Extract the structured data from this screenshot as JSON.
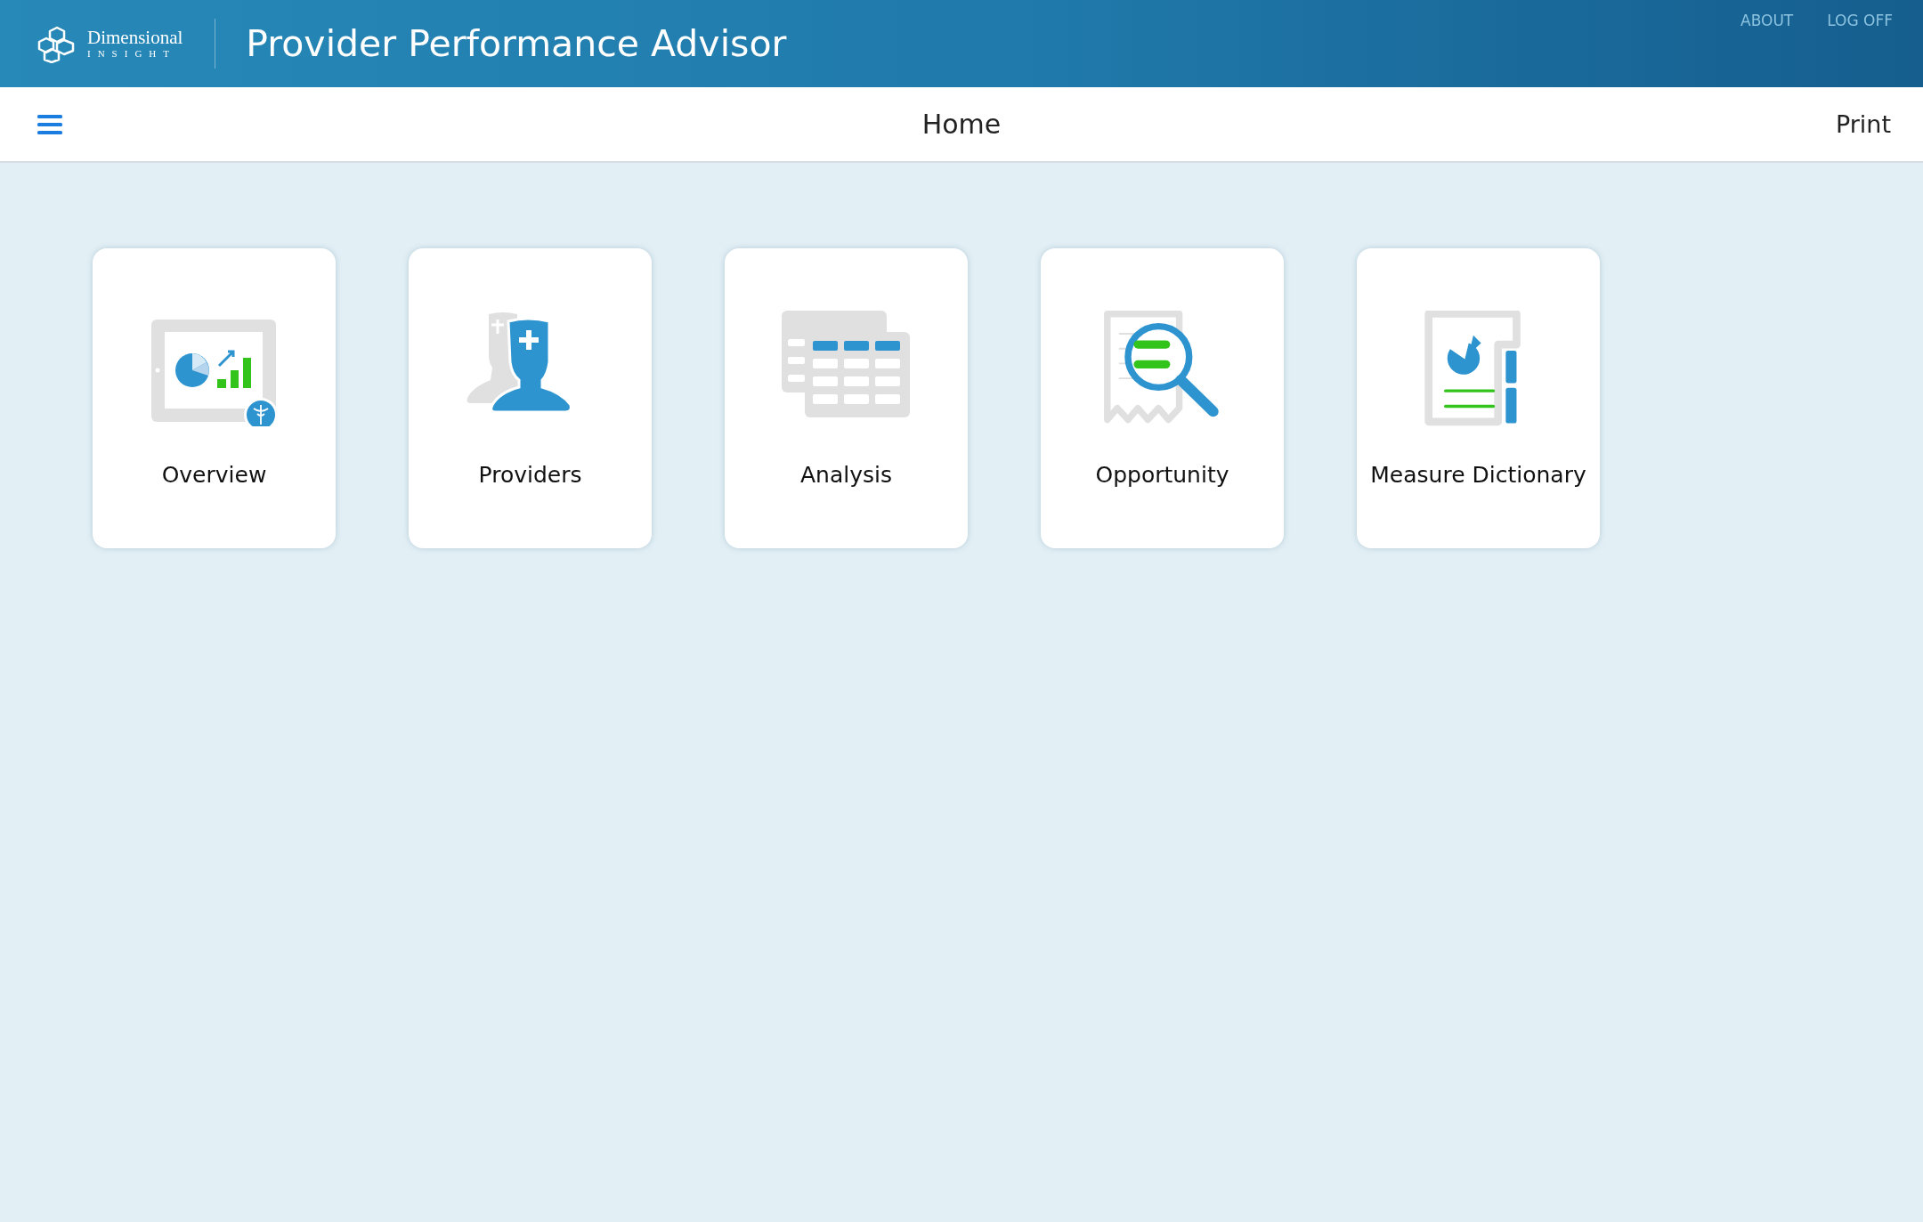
{
  "header": {
    "logo": {
      "name": "Dimensional",
      "tagline": "INSIGHT"
    },
    "title": "Provider Performance Advisor",
    "links": [
      "ABOUT",
      "LOG OFF"
    ]
  },
  "toolbar": {
    "title": "Home",
    "action": "Print"
  },
  "tiles": [
    {
      "kind": "overview",
      "label": "Overview"
    },
    {
      "kind": "providers",
      "label": "Providers"
    },
    {
      "kind": "analysis",
      "label": "Analysis"
    },
    {
      "kind": "opportunity",
      "label": "Opportunity"
    },
    {
      "kind": "dictionary",
      "label": "Measure Dictionary"
    }
  ]
}
